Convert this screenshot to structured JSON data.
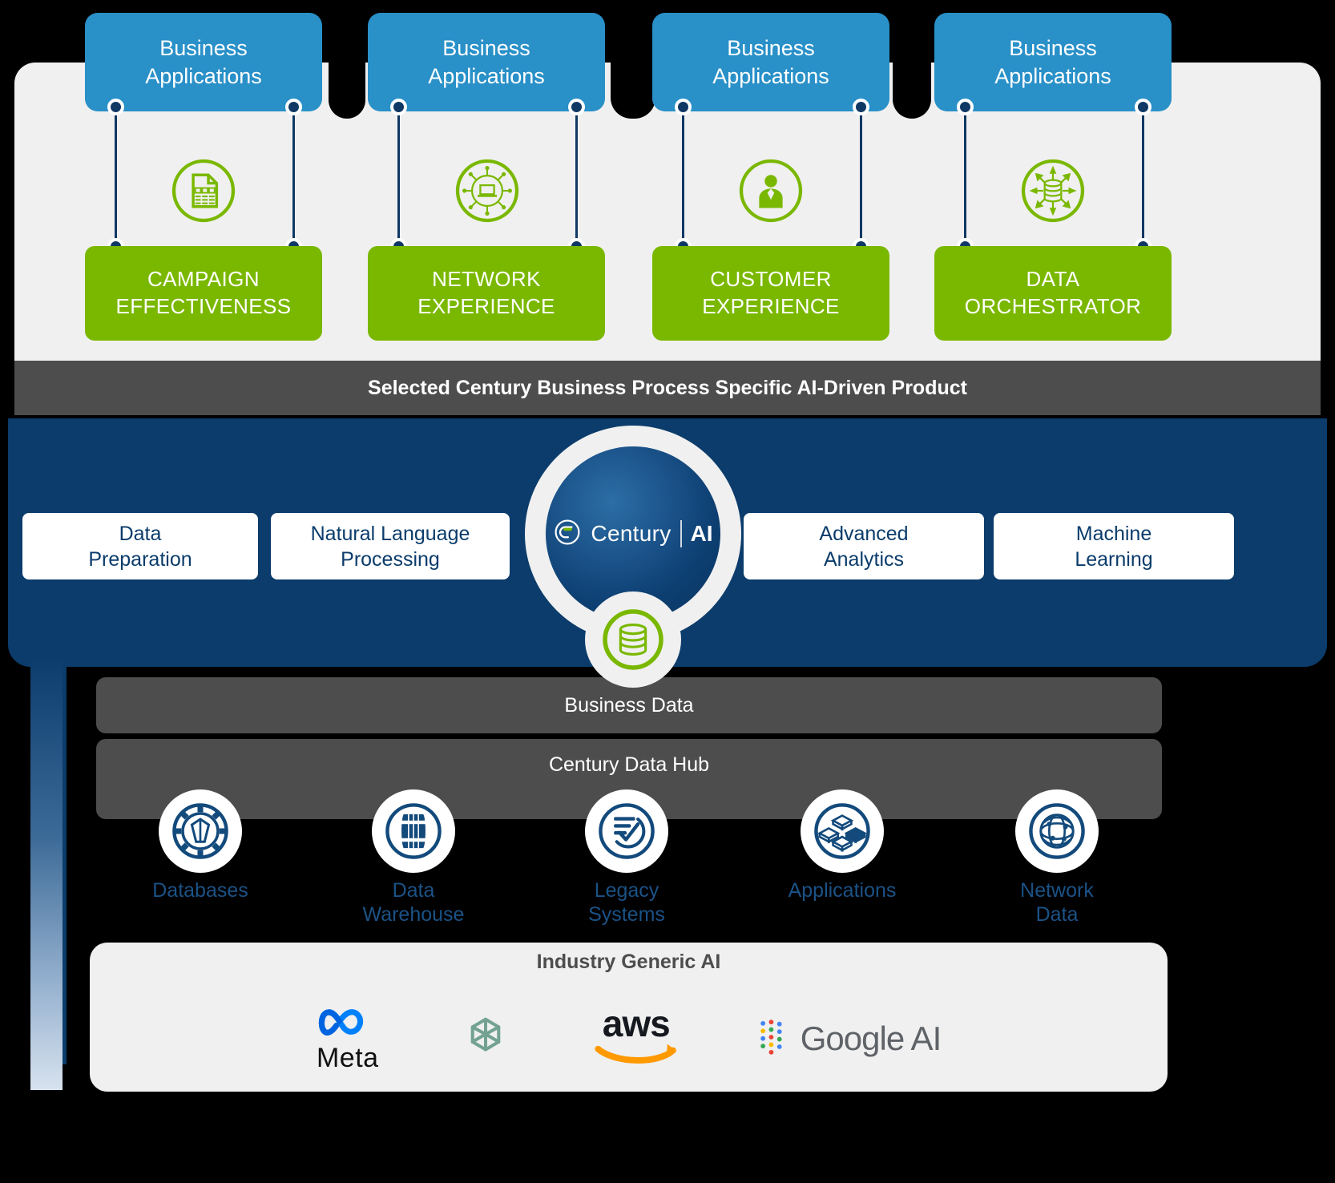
{
  "top_row": {
    "app_cards": [
      {
        "label": "Business\nApplications",
        "name": "business-applications-1"
      },
      {
        "label": "Business\nApplications",
        "name": "business-applications-2"
      },
      {
        "label": "Business\nApplications",
        "name": "business-applications-3"
      },
      {
        "label": "Business\nApplications",
        "name": "business-applications-4"
      }
    ],
    "icons": [
      {
        "name": "document-checklist-icon"
      },
      {
        "name": "network-laptop-icon"
      },
      {
        "name": "user-person-icon"
      },
      {
        "name": "data-orchestration-icon"
      }
    ],
    "product_cards": [
      {
        "line1": "CAMPAIGN",
        "line2": "EFFECTIVENESS"
      },
      {
        "line1": "NETWORK",
        "line2": "EXPERIENCE"
      },
      {
        "line1": "CUSTOMER",
        "line2": "EXPERIENCE"
      },
      {
        "line1": "DATA",
        "line2": "ORCHESTRATOR"
      }
    ]
  },
  "banner": {
    "text": "Selected Century Business Process Specific AI-Driven Product"
  },
  "platform": {
    "capabilities": [
      {
        "line1": "Data",
        "line2": "Preparation"
      },
      {
        "line1": "Natural Language",
        "line2": "Processing"
      },
      {
        "line1": "Advanced",
        "line2": "Analytics"
      },
      {
        "line1": "Machine",
        "line2": "Learning"
      }
    ],
    "brand": {
      "name": "Century",
      "suffix": "AI"
    }
  },
  "data_layer": {
    "business_data_label": "Business Data",
    "data_hub_label": "Century Data Hub",
    "sources": [
      {
        "label": "Databases",
        "icon": "databases-gear-icon"
      },
      {
        "label": "Data\nWarehouse",
        "icon": "data-warehouse-barrel-icon"
      },
      {
        "label": "Legacy\nSystems",
        "icon": "legacy-systems-checklist-icon"
      },
      {
        "label": "Applications",
        "icon": "applications-blocks-icon"
      },
      {
        "label": "Network\nData",
        "icon": "network-data-globe-icon"
      }
    ]
  },
  "generic_ai": {
    "title": "Industry Generic AI",
    "vendors": [
      {
        "name": "Meta",
        "icon": "meta-infinity-icon"
      },
      {
        "name": "",
        "icon": "openai-knot-icon"
      },
      {
        "name": "aws",
        "icon": "aws-smile-icon"
      },
      {
        "name": "Google AI",
        "icon": "google-dots-icon"
      }
    ]
  },
  "colors": {
    "blue_card": "#2990c8",
    "green": "#7ab800",
    "navy": "#0b3c6b",
    "grey": "#4d4d4d",
    "light": "#f0f0f0",
    "link_navy": "#1b5286"
  }
}
